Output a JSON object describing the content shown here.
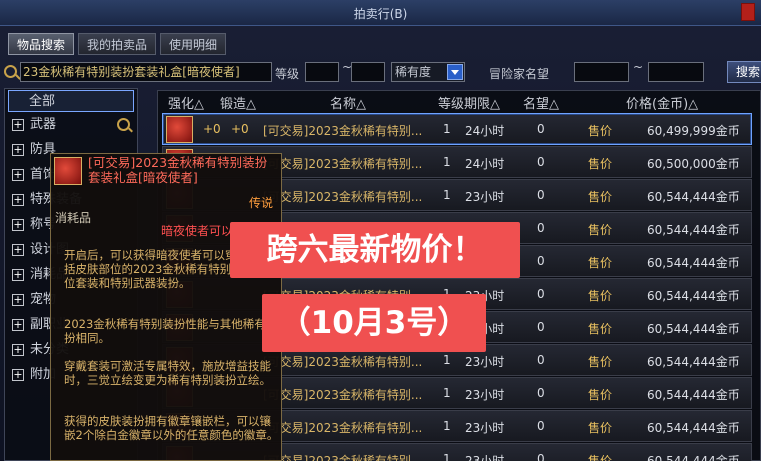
{
  "window": {
    "title": "拍卖行(B)"
  },
  "tabs": [
    {
      "label": "物品搜索",
      "active": true
    },
    {
      "label": "我的拍卖品",
      "active": false
    },
    {
      "label": "使用明细",
      "active": false
    }
  ],
  "search": {
    "item_value": "23金秋稀有特别装扮套装礼盒[暗夜使者]",
    "level_label": "等级",
    "tilde": "~",
    "rarity_label": "稀有度",
    "reputation_label": "冒险家名望",
    "search_button": "搜索"
  },
  "sidebar": {
    "items": [
      {
        "label": "全部",
        "selected": true
      },
      {
        "label": "武器"
      },
      {
        "label": "防具"
      },
      {
        "label": "首饰"
      },
      {
        "label": "特殊装备"
      },
      {
        "label": "称号"
      },
      {
        "label": "设计图"
      },
      {
        "label": "消耗品"
      },
      {
        "label": "宠物"
      },
      {
        "label": "副职业"
      },
      {
        "label": "未分类"
      },
      {
        "label": "附加"
      }
    ],
    "plus": "+"
  },
  "table": {
    "headers": [
      "强化△",
      "锻造△",
      "名称△",
      "等级期限△",
      "名望△",
      "价格(金币)△"
    ],
    "rows": [
      {
        "enhance": "+0",
        "forge": "+0",
        "name": "[可交易]2023金秋稀有特别...",
        "level": "1",
        "expiry": "24小时",
        "fame": "0",
        "mode": "售价",
        "price": "60,499,999金币"
      },
      {
        "enhance": "",
        "forge": "",
        "name": "[可交易]2023金秋稀有特别...",
        "level": "1",
        "expiry": "24小时",
        "fame": "0",
        "mode": "售价",
        "price": "60,500,000金币"
      },
      {
        "enhance": "",
        "forge": "",
        "name": "[可交易]2023金秋稀有特别...",
        "level": "1",
        "expiry": "23小时",
        "fame": "0",
        "mode": "售价",
        "price": "60,544,444金币"
      },
      {
        "enhance": "",
        "forge": "",
        "name": "[可交易]2023金秋稀有特别...",
        "level": "1",
        "expiry": "23小时",
        "fame": "0",
        "mode": "售价",
        "price": "60,544,444金币"
      },
      {
        "enhance": "",
        "forge": "",
        "name": "[可交易]2023金秋稀有特别...",
        "level": "1",
        "expiry": "23小时",
        "fame": "0",
        "mode": "售价",
        "price": "60,544,444金币"
      },
      {
        "enhance": "",
        "forge": "",
        "name": "[可交易]2023金秋稀有特别...",
        "level": "1",
        "expiry": "23小时",
        "fame": "0",
        "mode": "售价",
        "price": "60,544,444金币"
      },
      {
        "enhance": "",
        "forge": "",
        "name": "[可交易]2023金秋稀有特别...",
        "level": "1",
        "expiry": "23小时",
        "fame": "0",
        "mode": "售价",
        "price": "60,544,444金币"
      },
      {
        "enhance": "",
        "forge": "",
        "name": "[可交易]2023金秋稀有特别...",
        "level": "1",
        "expiry": "23小时",
        "fame": "0",
        "mode": "售价",
        "price": "60,544,444金币"
      },
      {
        "enhance": "",
        "forge": "",
        "name": "[可交易]2023金秋稀有特别...",
        "level": "1",
        "expiry": "23小时",
        "fame": "0",
        "mode": "售价",
        "price": "60,544,444金币"
      },
      {
        "enhance": "",
        "forge": "",
        "name": "[可交易]2023金秋稀有特别...",
        "level": "1",
        "expiry": "23小时",
        "fame": "0",
        "mode": "售价",
        "price": "60,544,444金币"
      },
      {
        "enhance": "",
        "forge": "",
        "name": "[可交易]2023金秋稀有特别...",
        "level": "1",
        "expiry": "23小时",
        "fame": "0",
        "mode": "售价",
        "price": "60,544,444金币"
      }
    ]
  },
  "tooltip": {
    "title": "[可交易]2023金秋稀有特别装扮套装礼盒[暗夜使者]",
    "rarity": "传说",
    "type": "消耗品",
    "set_note": "暗夜使者可以",
    "p1": "开启后，可以获得暗夜使者可以穿戴的包括皮肤部位的2023金秋稀有特别装扮9部位套装和特别武器装扮。",
    "p2": "2023金秋稀有特别装扮性能与其他稀有装扮相同。",
    "p3": "穿戴套装可激活专属特效，施放增益技能时，三觉立绘变更为稀有特别装扮立绘。",
    "p4": "获得的皮肤装扮拥有徽章镶嵌栏，可以镶嵌2个除白金徽章以外的任意颜色的徽章。"
  },
  "overlay": {
    "line1": "跨六最新物价！",
    "line2": "（10月3号）"
  }
}
